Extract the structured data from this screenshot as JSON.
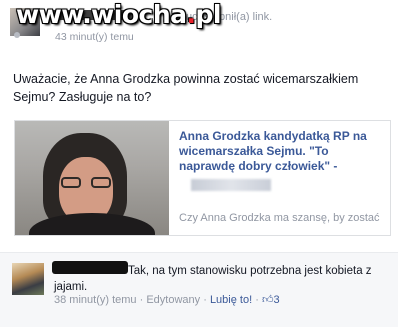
{
  "watermark": {
    "text_main": "www.wiocha",
    "text_dot": ".",
    "text_tld": "pl"
  },
  "top": {
    "action": "udostępnił(a) link.",
    "time": "43 minut(y) temu"
  },
  "post": {
    "text": "Uważacie, że Anna Grodzka powinna zostać wicemarszałkiem Sejmu? Zasługuje na to?"
  },
  "link_card": {
    "title": "Anna Grodzka kandydatką RP na wicemarszałka Sejmu. \"To naprawdę dobry człowiek\" -",
    "description": "Czy Anna Grodzka ma szansę, by zostać"
  },
  "comment": {
    "text": "Tak, na tym stanowisku potrzebna jest kobieta z jajami.",
    "time": "38 minut(y) temu",
    "edited": "Edytowany",
    "like_label": "Lubię to!",
    "like_count": "3",
    "separator": "·"
  },
  "colors": {
    "link": "#3b5998",
    "meta": "#9197a3",
    "text": "#141823",
    "comment_bg": "#f6f7f9"
  },
  "icons": {
    "like": "thumbs-up-icon"
  }
}
